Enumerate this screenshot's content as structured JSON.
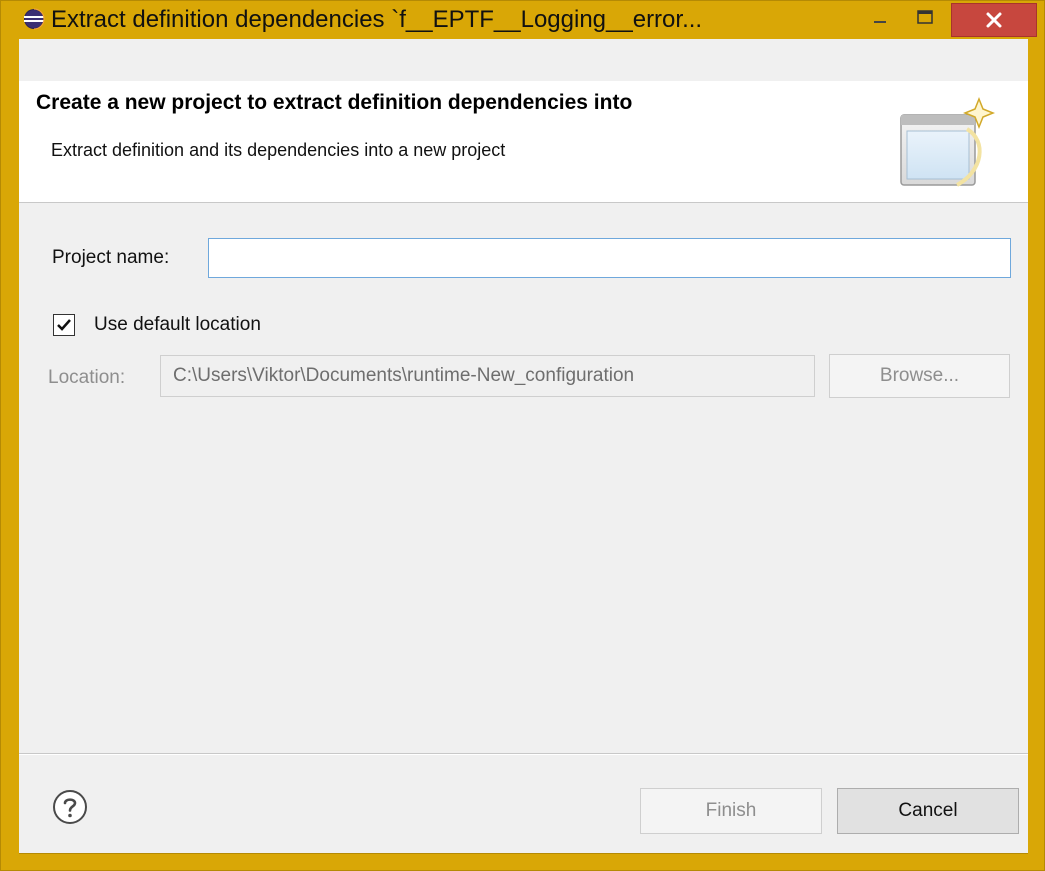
{
  "window": {
    "title": "Extract definition dependencies `f__EPTF__Logging__error...",
    "accent_color": "#d9a706",
    "close_color": "#c7473e",
    "icons": {
      "app": "eclipse-icon",
      "minimize": "minimize-icon",
      "maximize": "maximize-icon",
      "close": "close-icon"
    }
  },
  "header": {
    "title": "Create a new project to extract definition dependencies into",
    "description": "Extract definition and its dependencies into a new project",
    "banner_icon": "new-project-wizard-icon"
  },
  "form": {
    "project_name_label": "Project name:",
    "project_name_value": "",
    "use_default_location_label": "Use default location",
    "use_default_location_checked": true,
    "location_label": "Location:",
    "location_value": "C:\\Users\\Viktor\\Documents\\runtime-New_configuration",
    "browse_label": "Browse..."
  },
  "footer": {
    "help_icon": "help-icon",
    "finish_label": "Finish",
    "finish_enabled": false,
    "cancel_label": "Cancel"
  }
}
